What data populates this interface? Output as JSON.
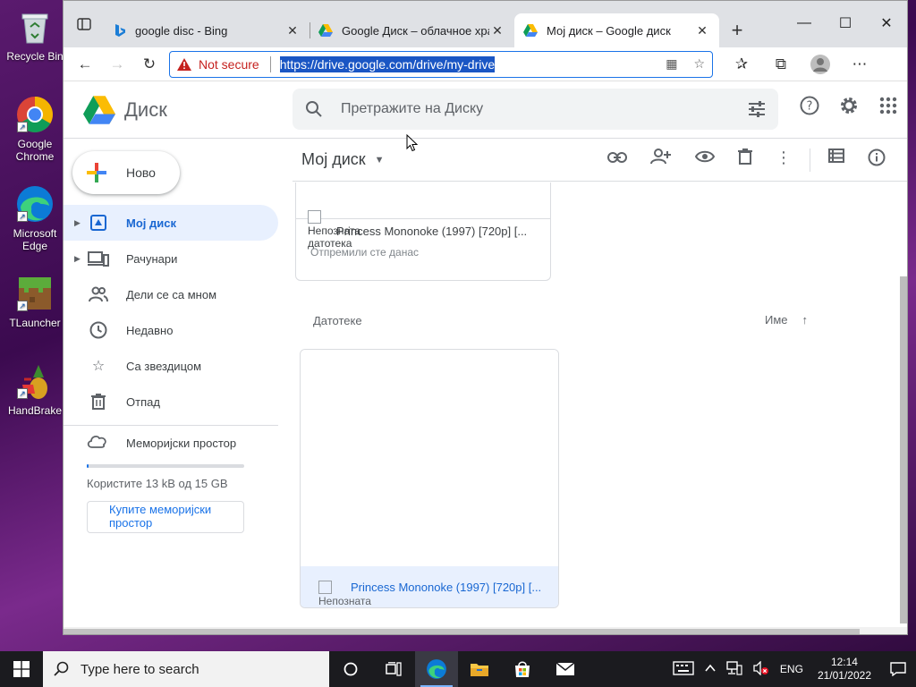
{
  "desktop": {
    "icons": [
      {
        "label": "Recycle Bin"
      },
      {
        "label": "Google Chrome"
      },
      {
        "label": "Microsoft Edge"
      },
      {
        "label": "TLauncher"
      },
      {
        "label": "HandBrake"
      }
    ]
  },
  "browser": {
    "tabs": [
      {
        "title": "google disc - Bing",
        "icon": "bing-icon"
      },
      {
        "title": "Google Диск – облачное хран",
        "icon": "google-drive-icon"
      },
      {
        "title": "Мој диск – Google диск",
        "icon": "google-drive-icon",
        "active": true
      }
    ],
    "address": {
      "security_label": "Not secure",
      "url": "https://drive.google.com/drive/my-drive"
    }
  },
  "drive": {
    "logo_text": "Диск",
    "search_placeholder": "Претражите на Диску",
    "new_button": "Ново",
    "nav": [
      {
        "label": "Мој диск",
        "icon": "drive-icon",
        "active": true,
        "expandable": true
      },
      {
        "label": "Рачунари",
        "icon": "computer-icon",
        "expandable": true
      },
      {
        "label": "Дели се са мном",
        "icon": "people-icon"
      },
      {
        "label": "Недавно",
        "icon": "clock-icon"
      },
      {
        "label": "Са звездицом",
        "icon": "star-icon"
      },
      {
        "label": "Отпад",
        "icon": "trash-icon"
      }
    ],
    "storage": {
      "label": "Меморијски простор",
      "used_text": "Користите 13 kB од 15 GB",
      "used_fraction": 0.01,
      "buy_label": "Купите меморијски простор"
    },
    "main": {
      "title": "Мој диск",
      "suggested": {
        "type_label": "Непозната датотека",
        "name": "Princess Mononoke (1997) [720p] [...",
        "subtitle": "Отпремили сте данас"
      },
      "files_label": "Датотеке",
      "sort_label": "Име",
      "file": {
        "name": "Princess Mononoke (1997) [720p] [...",
        "type_label": "Непозната"
      }
    }
  },
  "taskbar": {
    "search_placeholder": "Type here to search",
    "language": "ENG",
    "time": "12:14",
    "date": "21/01/2022"
  },
  "colors": {
    "accent": "#1a73e8",
    "active_nav_bg": "#e8f0fe",
    "not_secure": "#c5221f"
  }
}
